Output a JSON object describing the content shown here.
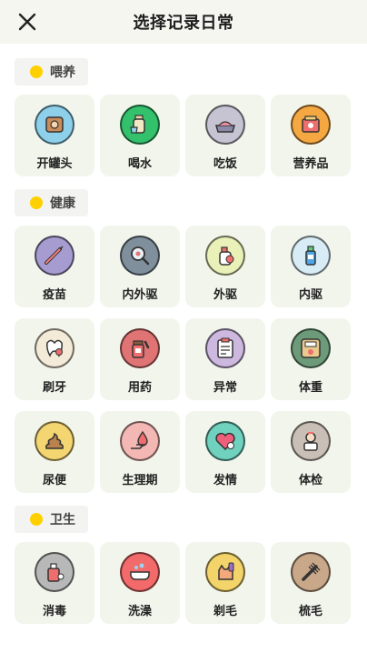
{
  "header": {
    "title": "选择记录日常"
  },
  "accent": "#ffd000",
  "sections": [
    {
      "label": "喂养",
      "items": [
        {
          "name": "开罐头",
          "icon": "can-icon",
          "color": "#8ed0ea"
        },
        {
          "name": "喝水",
          "icon": "water-bottle-icon",
          "color": "#33c16c"
        },
        {
          "name": "吃饭",
          "icon": "food-bowl-icon",
          "color": "#c6c4d2"
        },
        {
          "name": "营养品",
          "icon": "supplement-box-icon",
          "color": "#f5a742"
        }
      ]
    },
    {
      "label": "健康",
      "items": [
        {
          "name": "疫苗",
          "icon": "syringe-icon",
          "color": "#a79ccf"
        },
        {
          "name": "内外驱",
          "icon": "magnifier-bug-icon",
          "color": "#7f8f9c"
        },
        {
          "name": "外驱",
          "icon": "spray-bottle-icon",
          "color": "#e9f0b8"
        },
        {
          "name": "内驱",
          "icon": "medicine-bottle-icon",
          "color": "#d8ecf6"
        },
        {
          "name": "刷牙",
          "icon": "tooth-icon",
          "color": "#f4ead8"
        },
        {
          "name": "用药",
          "icon": "pill-bottle-icon",
          "color": "#e07474"
        },
        {
          "name": "异常",
          "icon": "clipboard-icon",
          "color": "#cdb8df"
        },
        {
          "name": "体重",
          "icon": "scale-icon",
          "color": "#6d9b7a"
        },
        {
          "name": "尿便",
          "icon": "poop-icon",
          "color": "#f3d571"
        },
        {
          "name": "生理期",
          "icon": "drop-hand-icon",
          "color": "#f3b8b4"
        },
        {
          "name": "发情",
          "icon": "heart-icon",
          "color": "#6fd1be"
        },
        {
          "name": "体检",
          "icon": "doctor-icon",
          "color": "#c9bfb7"
        }
      ]
    },
    {
      "label": "卫生",
      "items": [
        {
          "name": "消毒",
          "icon": "sanitizer-icon",
          "color": "#b8b8b8"
        },
        {
          "name": "洗澡",
          "icon": "bathtub-icon",
          "color": "#f36a6a"
        },
        {
          "name": "剃毛",
          "icon": "clipper-cat-icon",
          "color": "#f2d46b"
        },
        {
          "name": "梳毛",
          "icon": "comb-icon",
          "color": "#c9a789"
        }
      ]
    }
  ]
}
